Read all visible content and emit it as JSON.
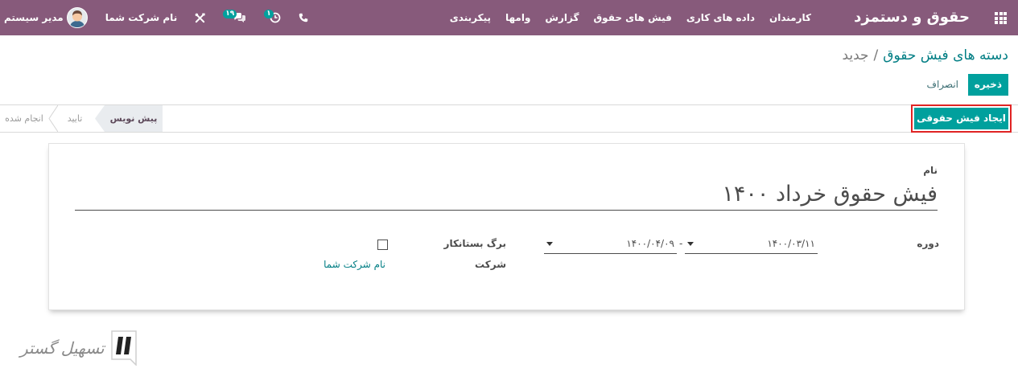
{
  "colors": {
    "navbar": "#875A7B",
    "primary": "#00A09D",
    "link": "#017E84",
    "highlight": "#E02424",
    "stage_active_bg": "#E9ECEF"
  },
  "icons": {
    "apps": "apps-grid-icon",
    "phone": "phone-icon",
    "activities": "clock-icon",
    "messages": "chat-icon",
    "debug": "debug-tools-icon",
    "avatar": "user-avatar",
    "date_dropdown": "caret-down-icon",
    "stage_separator": "chevron-left-icon"
  },
  "navbar": {
    "brand": "حقوق و دستمزد",
    "menu": [
      "کارمندان",
      "داده های کاری",
      "فیش های حقوق",
      "گزارش",
      "وامها",
      "پیکربندی"
    ],
    "activity_count": "۱",
    "message_count": "۱۹",
    "company": "نام شرکت شما",
    "user": "مدیر سیستم"
  },
  "breadcrumb": {
    "parent": "دسته های فیش حقوق",
    "separator": "/",
    "current": "جدید"
  },
  "actions": {
    "save": "ذخیره",
    "discard": "انصراف"
  },
  "statusbar": {
    "action_button": "ایجاد فیش حقوقی",
    "stages": [
      {
        "label": "پیش نویس",
        "active": true
      },
      {
        "label": "تایید",
        "active": false
      },
      {
        "label": "انجام شده",
        "active": false
      }
    ]
  },
  "form": {
    "name_label": "نام",
    "name_value": "فیش حقوق خرداد ۱۴۰۰",
    "period_label": "دوره",
    "date_start": "۱۴۰۰/۰۳/۱۱",
    "date_separator": "-",
    "date_end": "۱۴۰۰/۰۴/۰۹",
    "credit_note_label": "برگ بستانکار",
    "credit_note_checked": false,
    "company_label": "شرکت",
    "company_value": "نام شرکت شما"
  },
  "watermark": {
    "logo_text": "تسهیل گستر"
  }
}
